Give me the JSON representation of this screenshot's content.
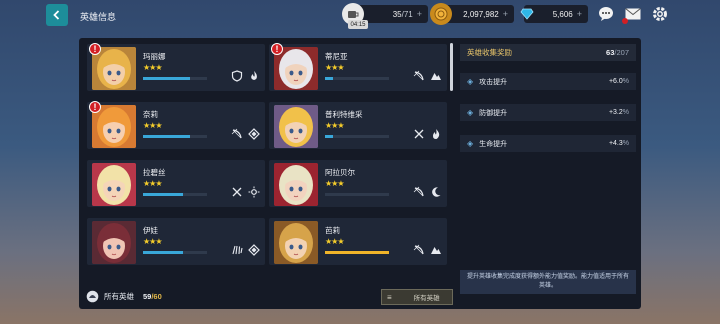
{
  "header": {
    "title": "英雄信息"
  },
  "resources": {
    "stamina": {
      "value": "35",
      "max": "/71",
      "timer": "04:15"
    },
    "gold": {
      "value": "2,097,982"
    },
    "gems": {
      "value": "5,606"
    }
  },
  "heroes": [
    {
      "name": "玛丽娜",
      "stars": "★★★",
      "progress": 0.73,
      "alert": true,
      "hair": "#e8b34a",
      "skin": "#f3cfa9",
      "bg": "#b9853a",
      "bar": "#39a7d9",
      "icons": [
        "shield-icon",
        "fire-swirl-icon"
      ]
    },
    {
      "name": "蒂尼亚",
      "stars": "★★★",
      "progress": 0.12,
      "alert": true,
      "hair": "#e8e6ea",
      "skin": "#f0d3bd",
      "bg": "#8d2b2b",
      "bar": "#39a7d9",
      "icons": [
        "bow-icon",
        "mountain-icon"
      ]
    },
    {
      "name": "奈莉",
      "stars": "★★★",
      "progress": 0.73,
      "alert": true,
      "hair": "#f09a3a",
      "skin": "#f6cfb0",
      "bg": "#d77a32",
      "bar": "#39a7d9",
      "icons": [
        "bow-icon",
        "diamond-icon"
      ]
    },
    {
      "name": "普利特维采",
      "stars": "★★★",
      "progress": 0.12,
      "alert": false,
      "hair": "#f1c14a",
      "skin": "#f2d2b6",
      "bg": "#6f5b87",
      "bar": "#39a7d9",
      "icons": [
        "crossed-swords-icon",
        "flame-icon"
      ]
    },
    {
      "name": "拉碧丝",
      "stars": "★★★",
      "progress": 0.62,
      "alert": false,
      "hair": "#f2e2a8",
      "skin": "#f5d5b8",
      "bg": "#b8374a",
      "bar": "#39a7d9",
      "icons": [
        "crossed-swords-icon",
        "sun-icon"
      ]
    },
    {
      "name": "阿拉贝尔",
      "stars": "★★★",
      "progress": 0.0,
      "alert": false,
      "hair": "#e9e3c5",
      "skin": "#f2d3bf",
      "bg": "#9c2430",
      "bar": "#39a7d9",
      "icons": [
        "bow-icon",
        "moon-icon"
      ]
    },
    {
      "name": "伊娃",
      "stars": "★★★",
      "progress": 0.62,
      "alert": false,
      "hair": "#7a2e38",
      "skin": "#f0c4b4",
      "bg": "#5a2a34",
      "bar": "#39a7d9",
      "icons": [
        "claw-icon",
        "diamond-icon"
      ]
    },
    {
      "name": "芭莉",
      "stars": "★★★",
      "progress": 1.0,
      "alert": false,
      "hair": "#d6a34a",
      "skin": "#f3d2b2",
      "bg": "#8a5a26",
      "bar": "#f0b429",
      "icons": [
        "bow-icon",
        "mountain-icon"
      ]
    }
  ],
  "footer": {
    "total_label": "所有英雄",
    "owned": "59",
    "total": "/60",
    "filter_label": "所有英雄"
  },
  "collection": {
    "title": "英雄收集奖励",
    "count": "63",
    "max": "/207",
    "bonuses": [
      {
        "label": "攻击提升",
        "value": "+6.0",
        "unit": "%"
      },
      {
        "label": "防御提升",
        "value": "+3.2",
        "unit": "%"
      },
      {
        "label": "生命提升",
        "value": "+4.3",
        "unit": "%"
      }
    ],
    "note": "提升英雄收集完成度获得额外能力值奖励。能力值适用于所有英雄。"
  },
  "colors": {
    "accent": "#1d8d9a",
    "gold": "#f5cd2b",
    "progress": "#39a7d9",
    "alert": "#d21f24"
  }
}
